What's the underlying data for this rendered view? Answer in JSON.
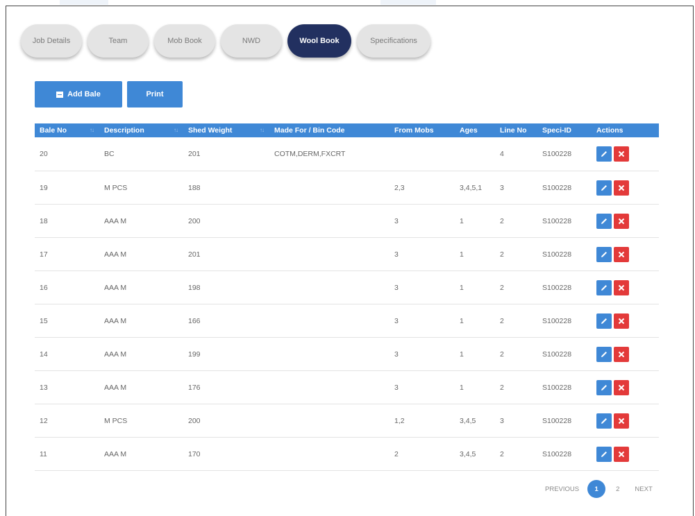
{
  "tabs": [
    {
      "label": "Job Details",
      "active": false
    },
    {
      "label": "Team",
      "active": false
    },
    {
      "label": "Mob Book",
      "active": false
    },
    {
      "label": "NWD",
      "active": false
    },
    {
      "label": "Wool Book",
      "active": true
    },
    {
      "label": "Specifications",
      "active": false
    }
  ],
  "toolbar": {
    "add_bale_label": "Add Bale",
    "print_label": "Print"
  },
  "table": {
    "headers": [
      "Bale No",
      "Description",
      "Shed Weight",
      "Made For / Bin Code",
      "From Mobs",
      "Ages",
      "Line No",
      "Speci-ID",
      "Actions"
    ],
    "sort_glyph": "↑↓",
    "rows": [
      [
        "20",
        "BC",
        "201",
        "COTM,DERM,FXCRT",
        "",
        "",
        "4",
        "S100228"
      ],
      [
        "19",
        "M PCS",
        "188",
        "",
        "2,3",
        "3,4,5,1",
        "3",
        "S100228"
      ],
      [
        "18",
        "AAA M",
        "200",
        "",
        "3",
        "1",
        "2",
        "S100228"
      ],
      [
        "17",
        "AAA M",
        "201",
        "",
        "3",
        "1",
        "2",
        "S100228"
      ],
      [
        "16",
        "AAA M",
        "198",
        "",
        "3",
        "1",
        "2",
        "S100228"
      ],
      [
        "15",
        "AAA M",
        "166",
        "",
        "3",
        "1",
        "2",
        "S100228"
      ],
      [
        "14",
        "AAA M",
        "199",
        "",
        "3",
        "1",
        "2",
        "S100228"
      ],
      [
        "13",
        "AAA M",
        "176",
        "",
        "3",
        "1",
        "2",
        "S100228"
      ],
      [
        "12",
        "M PCS",
        "200",
        "",
        "1,2",
        "3,4,5",
        "3",
        "S100228"
      ],
      [
        "11",
        "AAA M",
        "170",
        "",
        "2",
        "3,4,5",
        "2",
        "S100228"
      ]
    ],
    "actions": {
      "edit_icon": "pencil-icon",
      "delete_icon": "close-icon"
    }
  },
  "pagination": {
    "previous_label": "PREVIOUS",
    "pages": [
      "1",
      "2"
    ],
    "current_page": "1",
    "next_label": "NEXT"
  },
  "colors": {
    "primary": "#3f88d6",
    "active_tab": "#223060",
    "delete": "#e33a3a"
  }
}
